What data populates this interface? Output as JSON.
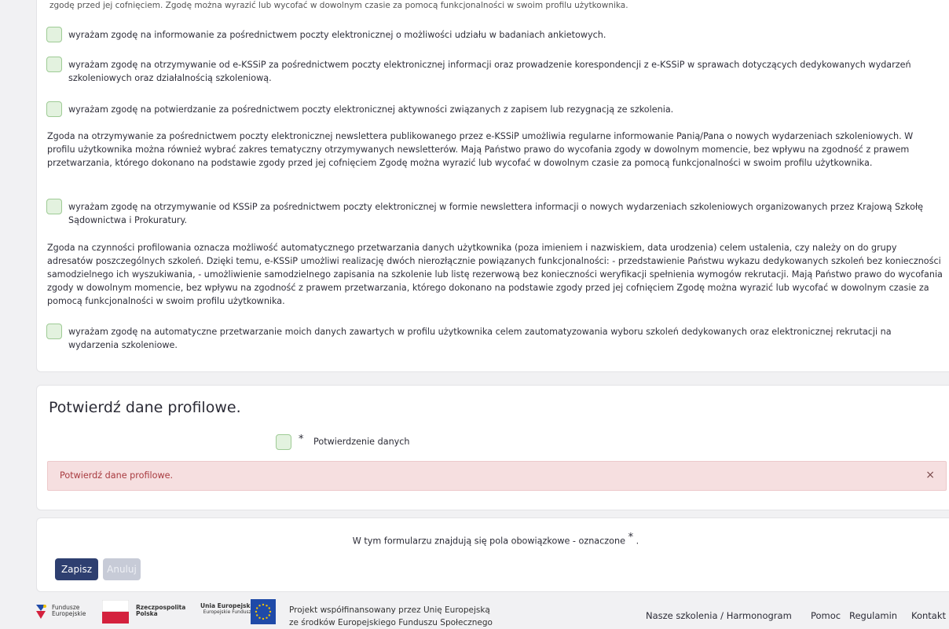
{
  "consents": {
    "truncated_top": "zgodę przed jej cofnięciem. Zgodę można wyrazić lub wycofać w dowolnym czasie za pomocą funkcjonalności w swoim profilu użytkownika.",
    "c1": "wyrażam zgodę na informowanie za pośrednictwem poczty elektronicznej o możliwości udziału w badaniach ankietowych.",
    "c2": "wyrażam zgodę na otrzymywanie od e-KSSiP za pośrednictwem poczty elektronicznej informacji oraz prowadzenie korespondencji z e-KSSiP w sprawach dotyczących dedykowanych wydarzeń szkoleniowych oraz działalnością szkoleniową.",
    "c3": "wyrażam zgodę na potwierdzanie za pośrednictwem poczty elektronicznej aktywności związanych z zapisem lub rezygnacją ze szkolenia.",
    "newsletter_info": "Zgoda na otrzymywanie za pośrednictwem poczty elektronicznej newslettera publikowanego przez e-KSSiP umożliwia regularne informowanie Panią/Pana o nowych wydarzeniach szkoleniowych. W profilu użytkownika można również wybrać zakres tematyczny otrzymywanych newsletterów. Mają Państwo prawo do wycofania zgody w dowolnym momencie, bez wpływu na zgodność z prawem przetwarzania, którego dokonano na podstawie zgody przed jej cofnięciem Zgodę można wyrazić lub wycofać w dowolnym czasie za pomocą funkcjonalności w swoim profilu użytkownika.",
    "c4": "wyrażam zgodę na otrzymywanie od KSSiP za pośrednictwem poczty elektronicznej w formie newslettera informacji o nowych wydarzeniach szkoleniowych organizowanych przez Krajową Szkołę Sądownictwa i Prokuratury.",
    "profiling_info": "Zgoda na czynności profilowania oznacza możliwość automatycznego przetwarzania danych użytkownika (poza imieniem i nazwiskiem, data urodzenia) celem ustalenia, czy należy on do grupy adresatów poszczególnych szkoleń. Dzięki temu, e-KSSiP umożliwi realizację dwóch nierozłącznie powiązanych funkcjonalności: - przedstawienie Państwu wykazu dedykowanych szkoleń bez konieczności samodzielnego ich wyszukiwania, - umożliwienie samodzielnego zapisania na szkolenie lub listę rezerwową bez konieczności weryfikacji spełnienia wymogów rekrutacji. Mają Państwo prawo do wycofania zgody w dowolnym momencie, bez wpływu na zgodność z prawem przetwarzania, którego dokonano na podstawie zgody przed jej cofnięciem Zgodę można wyrazić lub wycofać w dowolnym czasie za pomocą funkcjonalności w swoim profilu użytkownika.",
    "c5": "wyrażam zgodę na automatyczne przetwarzanie moich danych zawartych w profilu użytkownika celem zautomatyzowania wyboru szkoleń dedykowanych oraz elektronicznej rekrutacji na wydarzenia szkoleniowe."
  },
  "profile": {
    "title": "Potwierdź dane profilowe.",
    "required_star": "*",
    "confirm_label": "Potwierdzenie danych",
    "alert_text": "Potwierdź dane profilowe.",
    "alert_close": "×"
  },
  "actions": {
    "required_note": "W tym formularzu znajdują się pola obowiązkowe - oznaczone",
    "required_star": "*",
    "required_dot": ".",
    "save": "Zapisz",
    "cancel": "Anuluj"
  },
  "footer": {
    "logo_fe_1": "Fundusze",
    "logo_fe_2": "Europejskie",
    "logo_rp_1": "Rzeczpospolita",
    "logo_rp_2": "Polska",
    "logo_ue_1": "Unia Europejska",
    "logo_ue_2": "Europejskie Fundusze",
    "project_1": "Projekt współfinansowany przez Unię Europejską",
    "project_2": "ze środków Europejskiego Funduszu Społecznego",
    "nav": [
      "Nasze szkolenia / Harmonogram",
      "Pomoc",
      "Regulamin",
      "Kontakt"
    ]
  },
  "colors": {
    "primary_button": "#2e3f70",
    "checkbox_fill": "#e3f2df",
    "alert_bg": "#f6dfe0",
    "alert_text": "#a83a3f"
  }
}
